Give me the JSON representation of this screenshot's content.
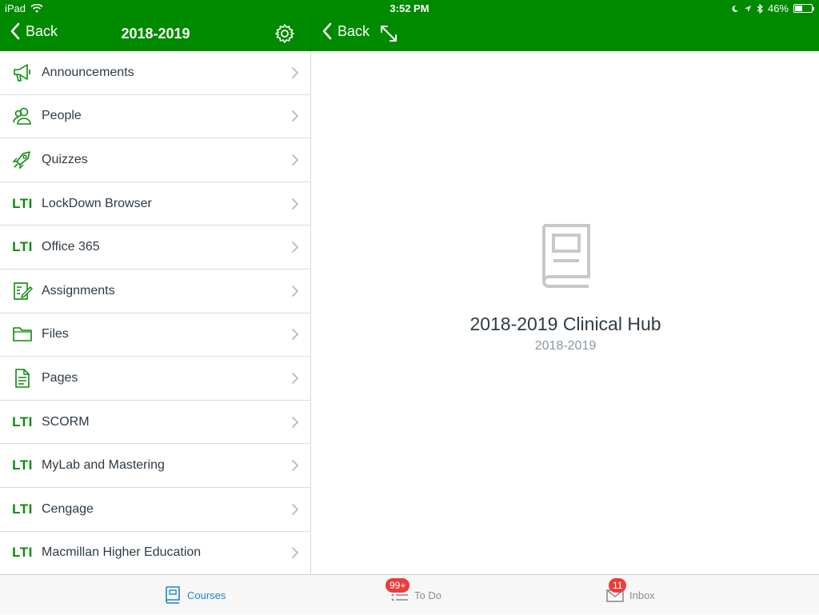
{
  "status": {
    "device": "iPad",
    "time": "3:52 PM",
    "battery": "46%",
    "battery_level": 0.46
  },
  "left_nav": {
    "back_label": "Back",
    "title": "2018-2019"
  },
  "right_nav": {
    "back_label": "Back"
  },
  "menu": [
    {
      "label": "Announcements",
      "icon": "megaphone-icon"
    },
    {
      "label": "People",
      "icon": "people-icon"
    },
    {
      "label": "Quizzes",
      "icon": "rocket-icon"
    },
    {
      "label": "LockDown Browser",
      "icon": "lti-icon",
      "icon_text": "LTI"
    },
    {
      "label": "Office 365",
      "icon": "lti-icon",
      "icon_text": "LTI"
    },
    {
      "label": "Assignments",
      "icon": "assignment-icon"
    },
    {
      "label": "Files",
      "icon": "folder-icon"
    },
    {
      "label": "Pages",
      "icon": "page-icon"
    },
    {
      "label": "SCORM",
      "icon": "lti-icon",
      "icon_text": "LTI"
    },
    {
      "label": "MyLab and Mastering",
      "icon": "lti-icon",
      "icon_text": "LTI"
    },
    {
      "label": "Cengage",
      "icon": "lti-icon",
      "icon_text": "LTI"
    },
    {
      "label": "Macmillan Higher Education",
      "icon": "lti-icon",
      "icon_text": "LTI"
    }
  ],
  "course": {
    "name": "2018-2019 Clinical Hub",
    "term": "2018-2019"
  },
  "tabs": {
    "courses": {
      "label": "Courses"
    },
    "todo": {
      "label": "To Do",
      "badge": "99+"
    },
    "inbox": {
      "label": "Inbox",
      "badge": "11"
    }
  },
  "colors": {
    "brand": "#008a00",
    "active_tab": "#1f86c8",
    "badge": "#ee3b3b"
  }
}
